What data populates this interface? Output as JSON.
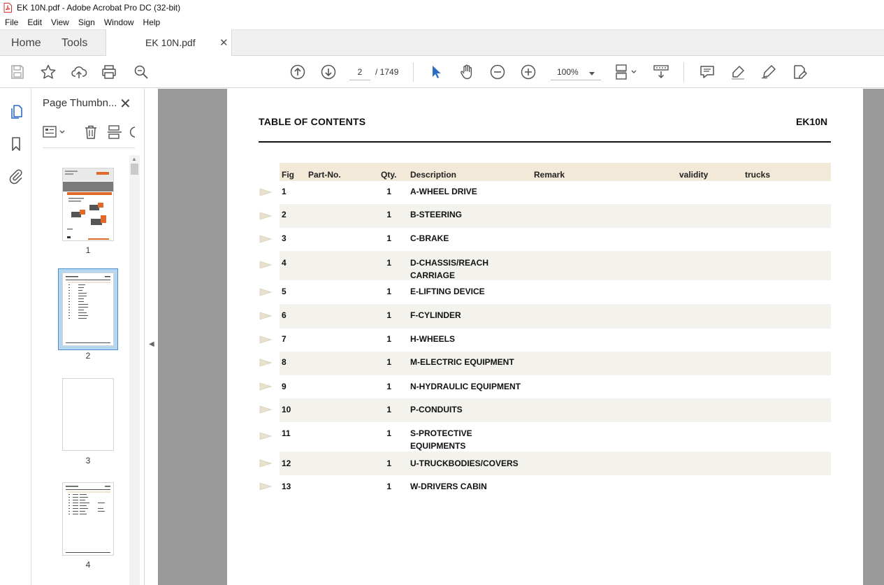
{
  "window": {
    "title": "EK 10N.pdf - Adobe Acrobat Pro DC (32-bit)"
  },
  "menu": [
    "File",
    "Edit",
    "View",
    "Sign",
    "Window",
    "Help"
  ],
  "tabs": {
    "home": "Home",
    "tools": "Tools",
    "document": "EK 10N.pdf"
  },
  "toolbar": {
    "current_page": "2",
    "page_total": "/ 1749",
    "zoom": "100%"
  },
  "thumbnail_panel": {
    "title": "Page Thumbn...",
    "pages": [
      {
        "number": "1",
        "selected": false
      },
      {
        "number": "2",
        "selected": true
      },
      {
        "number": "3",
        "selected": false
      },
      {
        "number": "4",
        "selected": false
      }
    ]
  },
  "document": {
    "heading": "TABLE OF CONTENTS",
    "model": "EK10N",
    "columns": [
      "Fig",
      "Part-No.",
      "Qty.",
      "Description",
      "Remark",
      "validity",
      "trucks"
    ],
    "rows": [
      {
        "fig": "1",
        "qty": "1",
        "description": "A-WHEEL DRIVE"
      },
      {
        "fig": "2",
        "qty": "1",
        "description": "B-STEERING"
      },
      {
        "fig": "3",
        "qty": "1",
        "description": "C-BRAKE"
      },
      {
        "fig": "4",
        "qty": "1",
        "description": "D-CHASSIS/REACH CARRIAGE"
      },
      {
        "fig": "5",
        "qty": "1",
        "description": "E-LIFTING DEVICE"
      },
      {
        "fig": "6",
        "qty": "1",
        "description": "F-CYLINDER"
      },
      {
        "fig": "7",
        "qty": "1",
        "description": "H-WHEELS"
      },
      {
        "fig": "8",
        "qty": "1",
        "description": "M-ELECTRIC EQUIPMENT"
      },
      {
        "fig": "9",
        "qty": "1",
        "description": "N-HYDRAULIC EQUIPMENT"
      },
      {
        "fig": "10",
        "qty": "1",
        "description": "P-CONDUITS"
      },
      {
        "fig": "11",
        "qty": "1",
        "description": "S-PROTECTIVE EQUIPMENTS"
      },
      {
        "fig": "12",
        "qty": "1",
        "description": "U-TRUCKBODIES/COVERS"
      },
      {
        "fig": "13",
        "qty": "1",
        "description": "W-DRIVERS CABIN"
      }
    ]
  },
  "colors": {
    "accent_blue": "#2b6cc4",
    "header_fill": "#f2e9d8",
    "row_shade": "#f3f2ec",
    "workspace_gray": "#9a9a9a",
    "pdf_red": "#d9302a"
  }
}
